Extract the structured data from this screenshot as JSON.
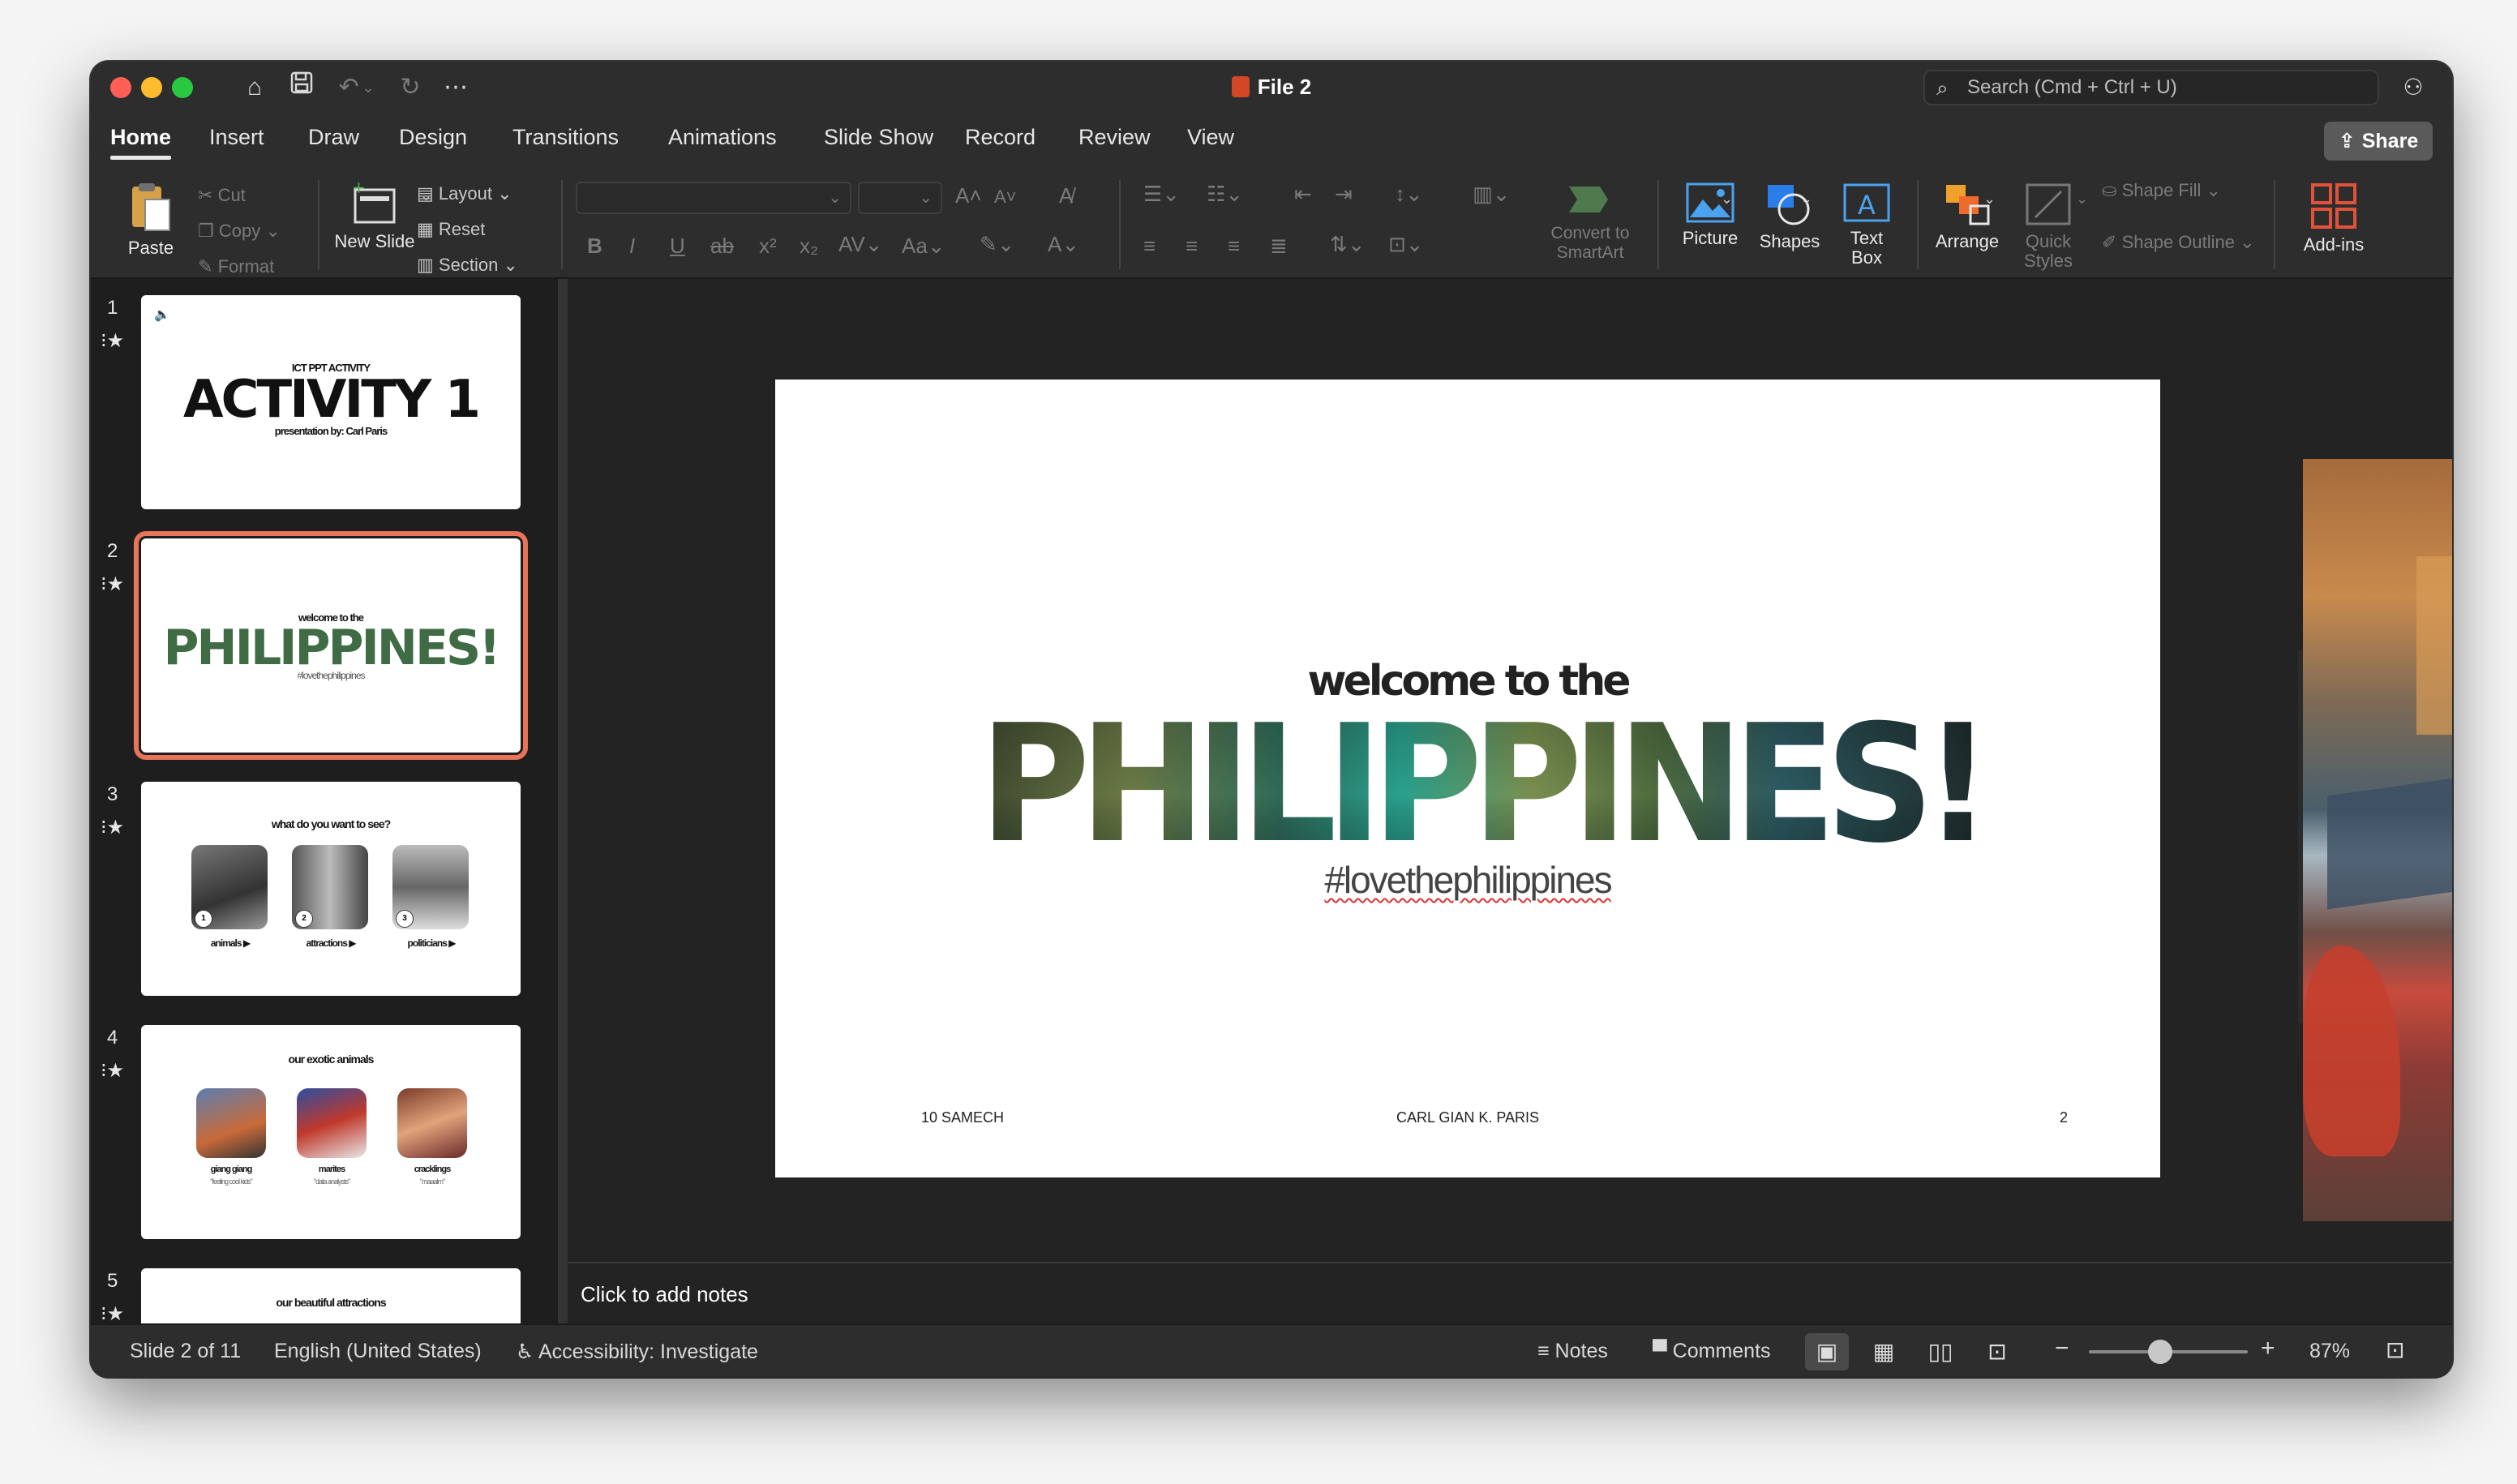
{
  "titlebar": {
    "title": "File 2",
    "search_placeholder": "Search (Cmd + Ctrl + U)",
    "icons": [
      "home-icon",
      "save-icon",
      "undo-icon",
      "redo-icon",
      "more-icon"
    ]
  },
  "tabs": [
    "Home",
    "Insert",
    "Draw",
    "Design",
    "Transitions",
    "Animations",
    "Slide Show",
    "Record",
    "Review",
    "View"
  ],
  "share_label": "Share",
  "ribbon": {
    "paste": "Paste",
    "cut": "Cut",
    "copy": "Copy",
    "format": "Format",
    "new_slide": "New Slide",
    "layout": "Layout",
    "reset": "Reset",
    "section": "Section",
    "convert_smartart": "Convert to SmartArt",
    "picture": "Picture",
    "shapes": "Shapes",
    "text_box": "Text Box",
    "arrange": "Arrange",
    "quick_styles": "Quick Styles",
    "shape_fill": "Shape Fill",
    "shape_outline": "Shape Outline",
    "add_ins": "Add-ins"
  },
  "thumbnails": [
    {
      "num": "1",
      "small": "ICT PPT ACTIVITY",
      "big": "ACTIVITY 1",
      "sub": "presentation by: Carl Paris"
    },
    {
      "num": "2",
      "small": "welcome to the",
      "big": "PHILIPPINES!",
      "sub": "#lovethephilippines"
    },
    {
      "num": "3",
      "small": "what do you want to see?",
      "labels": [
        "animals ▶",
        "attractions ▶",
        "politicians ▶"
      ],
      "badges": [
        "1",
        "2",
        "3"
      ]
    },
    {
      "num": "4",
      "small": "our exotic animals",
      "labels": [
        "giang giang",
        "marites",
        "cracklings"
      ],
      "captions": [
        "\"feeling cool kids\"",
        "\"data analysts\"",
        "\"maaalm\""
      ]
    },
    {
      "num": "5",
      "small": "our beautiful attractions"
    }
  ],
  "slide": {
    "welcome": "welcome to the",
    "title": "PHILIPPINES!",
    "hashtag": "#lovethephilippines",
    "footer_left": "10 SAMECH",
    "footer_center": "CARL GIAN K. PARIS",
    "footer_right": "2"
  },
  "notes_placeholder": "Click to add notes",
  "statusbar": {
    "slide_count": "Slide 2 of 11",
    "language": "English (United States)",
    "accessibility": "Accessibility: Investigate",
    "notes": "Notes",
    "comments": "Comments",
    "zoom": "87%",
    "zoom_fraction": 0.45
  },
  "colors": {
    "selection": "#e8745a",
    "ppt_brand": "#d24726",
    "accent_blue": "#4aa3f0"
  }
}
